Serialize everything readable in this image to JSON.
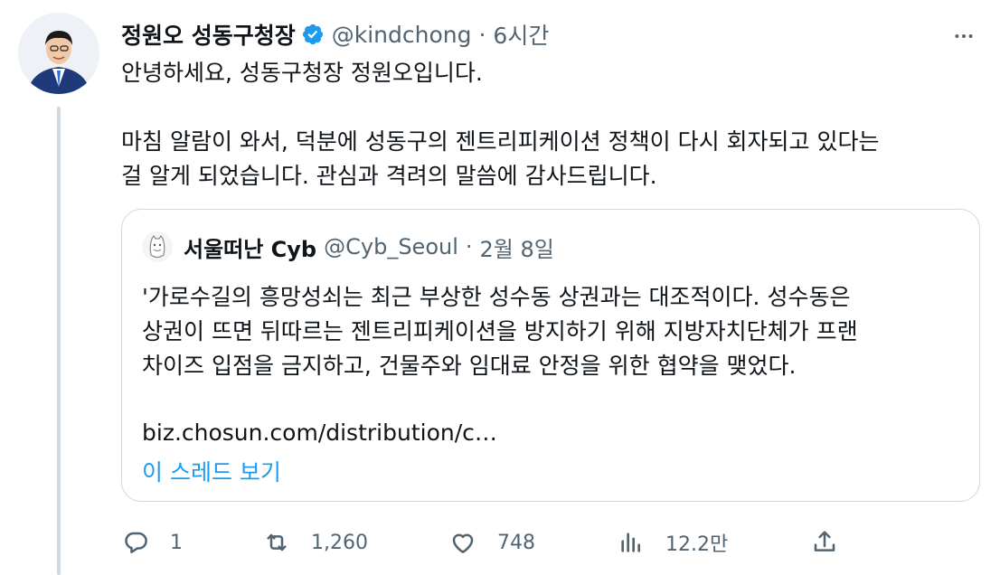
{
  "author": {
    "display_name": "정원오 성동구청장",
    "handle": "@kindchong",
    "separator": "·",
    "time": "6시간"
  },
  "body": {
    "line1": "안녕하세요, 성동구청장 정원오입니다.",
    "line2": "마침 알람이 와서, 덕분에 성동구의 젠트리피케이션 정책이 다시 회자되고 있다는",
    "line3": "걸 알게 되었습니다. 관심과 격려의 말씀에 감사드립니다."
  },
  "quote": {
    "display_name": "서울떠난 Cyb",
    "handle": "@Cyb_Seoul",
    "separator": "·",
    "time": "2월 8일",
    "line1": "'가로수길의 흥망성쇠는 최근 부상한 성수동 상권과는 대조적이다. 성수동은",
    "line2": "상권이 뜨면 뒤따르는 젠트리피케이션을 방지하기 위해 지방자치단체가 프랜",
    "line3": "차이즈 입점을 금지하고, 건물주와 임대료 안정을 위한 협약을 맺었다.",
    "link": "biz.chosun.com/distribution/c…",
    "show_thread": "이 스레드 보기"
  },
  "actions": {
    "reply_count": "1",
    "retweet_count": "1,260",
    "like_count": "748",
    "views_count": "12.2만"
  },
  "colors": {
    "accent": "#1d9bf0",
    "secondary_text": "#536471",
    "border": "#cfd9de"
  }
}
